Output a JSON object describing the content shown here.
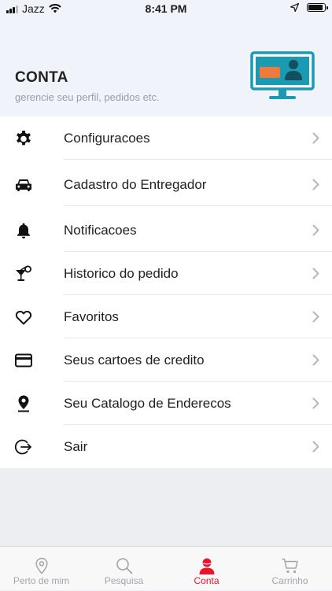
{
  "status_bar": {
    "carrier": "Jazz",
    "time": "8:41 PM",
    "battery_level": 0.9
  },
  "header": {
    "title": "CONTA",
    "subtitle": "gerencie seu perfil, pedidos etc.",
    "illustration_icon": "account-monitor-icon"
  },
  "menu": {
    "items": [
      {
        "label": "Configuracoes",
        "icon": "gear-icon"
      },
      {
        "label": "Cadastro do Entregador",
        "icon": "car-icon"
      },
      {
        "label": "Notificacoes",
        "icon": "bell-icon"
      },
      {
        "label": "Historico do pedido",
        "icon": "cocktail-icon"
      },
      {
        "label": "Favoritos",
        "icon": "heart-icon"
      },
      {
        "label": "Seus cartoes de credito",
        "icon": "credit-card-icon"
      },
      {
        "label": "Seu Catalogo de Enderecos",
        "icon": "location-pin-icon"
      },
      {
        "label": "Sair",
        "icon": "logout-icon"
      }
    ]
  },
  "tab_bar": {
    "tabs": [
      {
        "label": "Perto de mim",
        "icon": "map-pin-icon",
        "active": false
      },
      {
        "label": "Pesquisa",
        "icon": "search-icon",
        "active": false
      },
      {
        "label": "Conta",
        "icon": "user-icon",
        "active": true
      },
      {
        "label": "Carrinho",
        "icon": "cart-icon",
        "active": false
      }
    ]
  },
  "colors": {
    "accent": "#e8142c",
    "header_bg": "#f1f3fb",
    "illustration_teal": "#1a9bb3",
    "illustration_orange": "#f07a3c"
  }
}
